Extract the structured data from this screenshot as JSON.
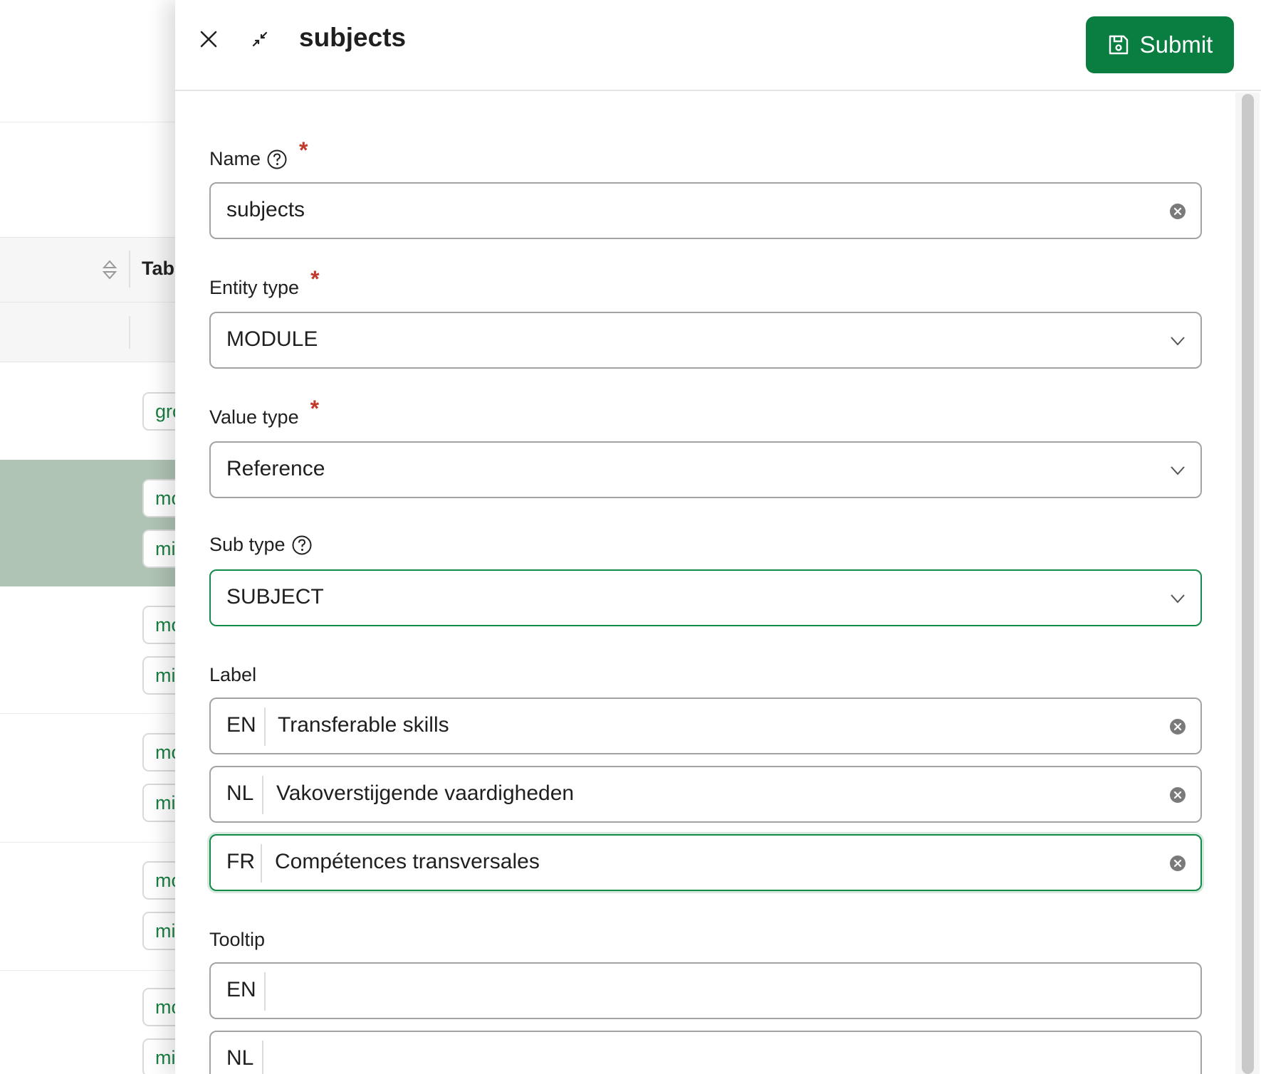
{
  "background": {
    "column_title": "Tabs",
    "tags": [
      "gro",
      "mo",
      "mi",
      "mo",
      "mi",
      "mo",
      "mi",
      "mo",
      "mi",
      "mo",
      "mi"
    ]
  },
  "drawer": {
    "title": "subjects",
    "submit_label": "Submit",
    "icons": {
      "close": "close-icon",
      "collapse": "collapse-icon",
      "save": "save-icon"
    }
  },
  "form": {
    "name": {
      "label": "Name",
      "value": "subjects",
      "required": true
    },
    "entity_type": {
      "label": "Entity type",
      "value": "MODULE",
      "required": true
    },
    "value_type": {
      "label": "Value type",
      "value": "Reference",
      "required": true
    },
    "sub_type": {
      "label": "Sub type",
      "value": "SUBJECT"
    },
    "label": {
      "label": "Label",
      "entries": [
        {
          "lang": "EN",
          "value": "Transferable skills"
        },
        {
          "lang": "NL",
          "value": "Vakoverstijgende vaardigheden"
        },
        {
          "lang": "FR",
          "value": "Compétences transversales"
        }
      ]
    },
    "tooltip": {
      "label": "Tooltip",
      "entries": [
        {
          "lang": "EN",
          "value": ""
        },
        {
          "lang": "NL",
          "value": ""
        }
      ]
    },
    "required_marker": "*"
  },
  "colors": {
    "accent": "#0a7d40",
    "focus_border": "#138a47",
    "required": "#c0392b",
    "tag_text": "#1a7f42",
    "row_highlight": "#b0c4b5"
  }
}
